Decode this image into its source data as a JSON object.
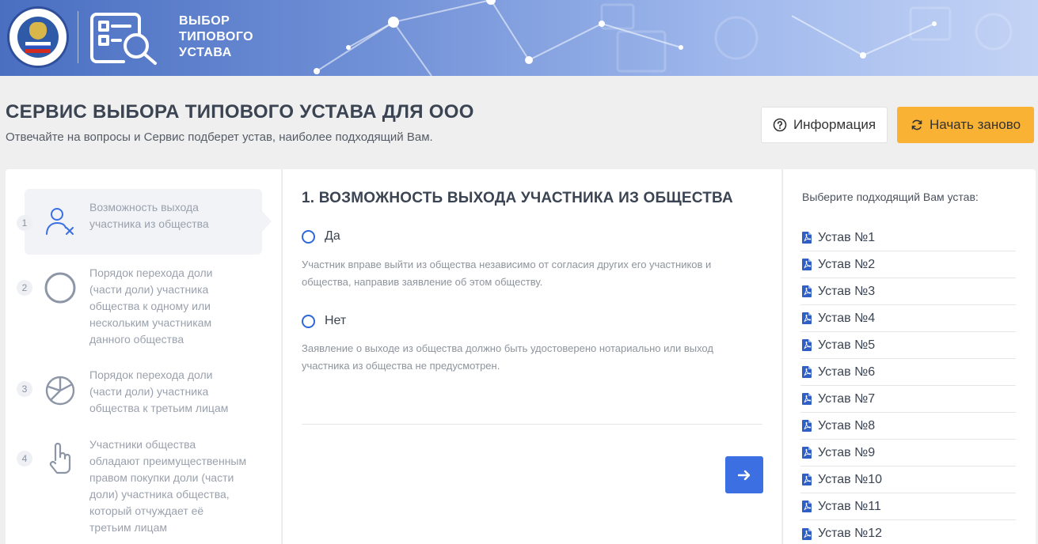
{
  "header": {
    "logo_text": [
      "ВЫБОР",
      "ТИПОВОГО",
      "УСТАВА"
    ]
  },
  "page": {
    "title": "СЕРВИС ВЫБОРА ТИПОВОГО УСТАВА ДЛЯ ООО",
    "subtitle": "Отвечайте на вопросы и Сервис подберет устав, наиболее подходящий Вам."
  },
  "buttons": {
    "info_label": "Информация",
    "restart_label": "Начать заново"
  },
  "steps": [
    {
      "num": "1",
      "text": "Возможность выхода участника из общества",
      "icon": "user-remove-icon",
      "active": true
    },
    {
      "num": "2",
      "text": "Порядок перехода доли (части доли) участника общества к одному или нескольким участникам данного общества",
      "icon": "circle-icon",
      "active": false
    },
    {
      "num": "3",
      "text": "Порядок перехода доли (части доли) участника общества к третьим лицам",
      "icon": "pie-chart-icon",
      "active": false
    },
    {
      "num": "4",
      "text": "Участники общества обладают преимущественным правом покупки доли (части доли) участника общества, который отчуждает её третьим лицам",
      "icon": "hand-pointer-icon",
      "active": false
    }
  ],
  "question": {
    "title": "1. ВОЗМОЖНОСТЬ ВЫХОДА УЧАСТНИКА ИЗ ОБЩЕСТВА",
    "options": [
      {
        "label": "Да",
        "desc": "Участник вправе выйти из общества независимо от согласия других его участников и общества, направив заявление об этом обществу."
      },
      {
        "label": "Нет",
        "desc": "Заявление о выходе из общества должно быть удостоверено нотариально или выход участника из общества не предусмотрен."
      }
    ]
  },
  "right": {
    "title": "Выберите подходящий Вам устав:",
    "items": [
      "Устав №1",
      "Устав №2",
      "Устав №3",
      "Устав №4",
      "Устав №5",
      "Устав №6",
      "Устав №7",
      "Устав №8",
      "Устав №9",
      "Устав №10",
      "Устав №11",
      "Устав №12"
    ]
  },
  "colors": {
    "accent_blue": "#3b6fe2",
    "accent_orange": "#f9b233",
    "header_blue": "#4a6fc1"
  }
}
